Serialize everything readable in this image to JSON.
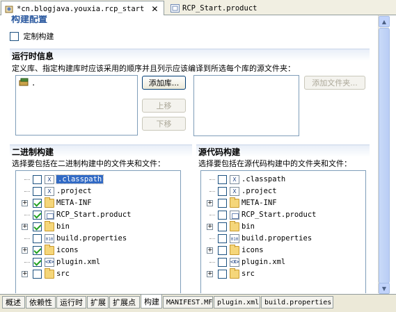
{
  "editor_tabs": [
    {
      "label": "*cn.blogjava.youxia.rcp_start",
      "active": true
    },
    {
      "label": "RCP_Start.product",
      "active": false
    }
  ],
  "header": {
    "cut_title": "构建配置",
    "custom_build_label": "定制构建",
    "custom_build_checked": false
  },
  "runtime": {
    "title": "运行时信息",
    "description": "定义库、指定构建库时应该采用的顺序并且列示应该编译到所选每个库的源文件夹：",
    "libraries": [
      {
        "label": ".",
        "icon": "library-jar-icon"
      }
    ],
    "buttons": {
      "add_library": "添加库...",
      "up": "上移",
      "down": "下移",
      "add_folder": "添加文件夹..."
    }
  },
  "binary_build": {
    "title": "二进制构建",
    "description": "选择要包括在二进制构建中的文件夹和文件：",
    "items": [
      {
        "label": ".classpath",
        "icon": "file-x-icon",
        "checked": false,
        "expandable": false,
        "selected": true
      },
      {
        "label": ".project",
        "icon": "file-x-icon",
        "checked": false,
        "expandable": false
      },
      {
        "label": "META-INF",
        "icon": "folder-icon",
        "checked": true,
        "expandable": true
      },
      {
        "label": "RCP_Start.product",
        "icon": "product-file-icon",
        "checked": true,
        "expandable": false
      },
      {
        "label": "bin",
        "icon": "folder-icon",
        "checked": true,
        "expandable": true
      },
      {
        "label": "build.properties",
        "icon": "properties-file-icon",
        "checked": false,
        "expandable": false
      },
      {
        "label": "icons",
        "icon": "folder-icon",
        "checked": true,
        "expandable": true
      },
      {
        "label": "plugin.xml",
        "icon": "xml-file-icon",
        "checked": true,
        "expandable": false
      },
      {
        "label": "src",
        "icon": "folder-icon",
        "checked": false,
        "expandable": true
      }
    ]
  },
  "source_build": {
    "title": "源代码构建",
    "description": "选择要包括在源代码构建中的文件夹和文件：",
    "items": [
      {
        "label": ".classpath",
        "icon": "file-x-icon",
        "checked": false,
        "expandable": false
      },
      {
        "label": ".project",
        "icon": "file-x-icon",
        "checked": false,
        "expandable": false
      },
      {
        "label": "META-INF",
        "icon": "folder-icon",
        "checked": false,
        "expandable": true
      },
      {
        "label": "RCP_Start.product",
        "icon": "product-file-icon",
        "checked": false,
        "expandable": false
      },
      {
        "label": "bin",
        "icon": "folder-icon",
        "checked": false,
        "expandable": true
      },
      {
        "label": "build.properties",
        "icon": "properties-file-icon",
        "checked": false,
        "expandable": false
      },
      {
        "label": "icons",
        "icon": "folder-icon",
        "checked": false,
        "expandable": true
      },
      {
        "label": "plugin.xml",
        "icon": "xml-file-icon",
        "checked": false,
        "expandable": false
      },
      {
        "label": "src",
        "icon": "folder-icon",
        "checked": false,
        "expandable": true
      }
    ]
  },
  "page_tabs": [
    {
      "label": "概述",
      "active": false
    },
    {
      "label": "依赖性",
      "active": false
    },
    {
      "label": "运行时",
      "active": false
    },
    {
      "label": "扩展",
      "active": false
    },
    {
      "label": "扩展点",
      "active": false
    },
    {
      "label": "构建",
      "active": true
    },
    {
      "label": "MANIFEST.MF",
      "active": false
    },
    {
      "label": "plugin.xml",
      "active": false
    },
    {
      "label": "build.properties",
      "active": false
    }
  ],
  "colors": {
    "selection": "#316ac5",
    "check": "#21a121",
    "section_title": "#2c5aa0"
  }
}
